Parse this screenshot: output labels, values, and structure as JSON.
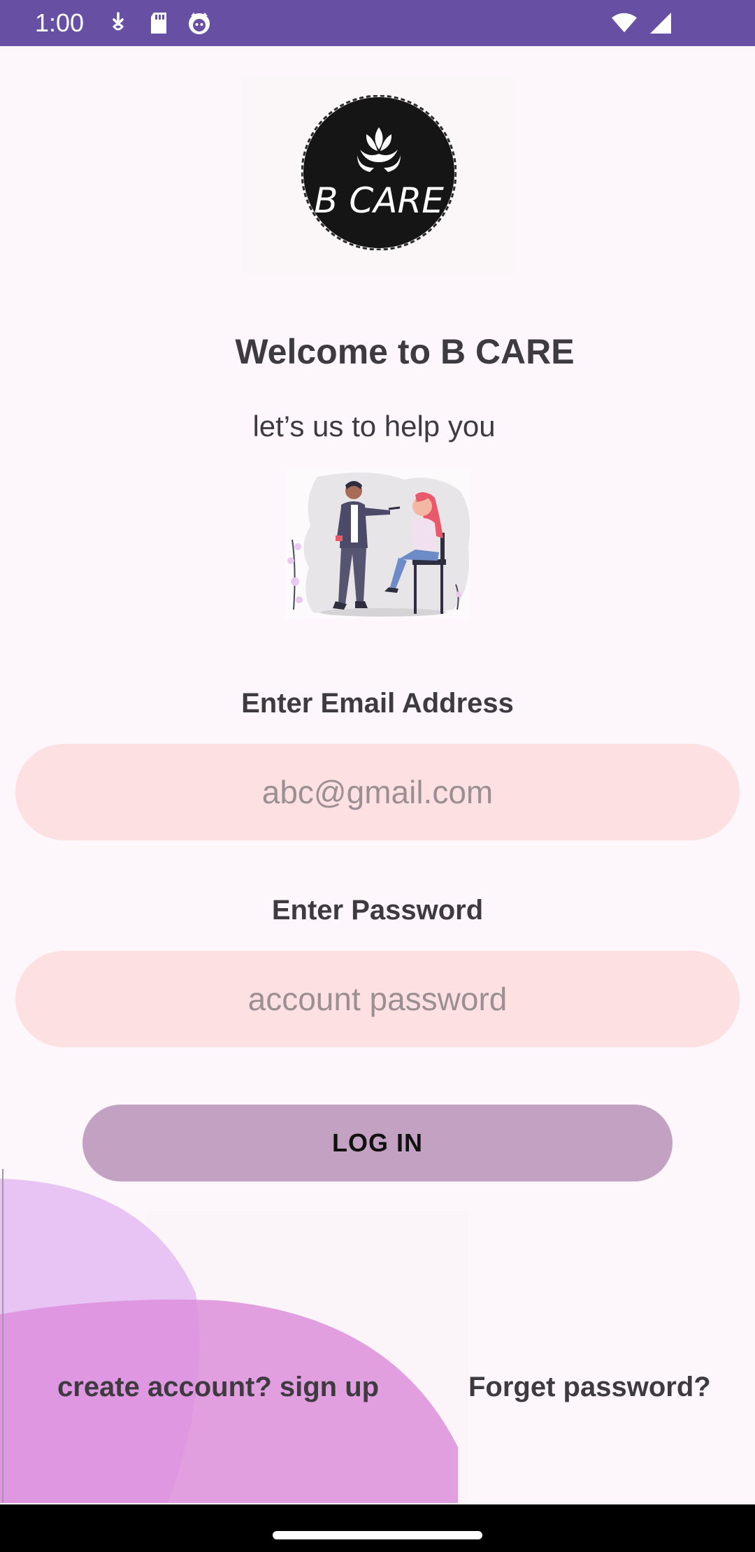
{
  "status_bar": {
    "time": "1:00",
    "left_icons": [
      "download-icon",
      "sd-card-icon",
      "face-icon"
    ],
    "right_icons": [
      "wifi-icon",
      "signal-icon"
    ],
    "color": "#6750a4"
  },
  "logo": {
    "text": "B CARE",
    "icon": "lotus-hands-icon"
  },
  "header": {
    "title": "Welcome to B CARE",
    "subtitle": "let’s us to help you"
  },
  "illustration": {
    "icon": "makeup-artist-illustration"
  },
  "form": {
    "email_label": "Enter Email Address",
    "email_placeholder": "abc@gmail.com",
    "email_value": "",
    "password_label": "Enter Password",
    "password_placeholder": "account password",
    "password_value": "",
    "login_label": "LOG IN"
  },
  "links": {
    "signup": "create account? sign up",
    "forget": "Forget password?"
  },
  "colors": {
    "background": "#fdf7fb",
    "input_fill": "#fde1e2",
    "button_fill": "#c3a1c3",
    "bubble_light": "#e7c4f4",
    "bubble_dark": "#dc8fdc"
  }
}
